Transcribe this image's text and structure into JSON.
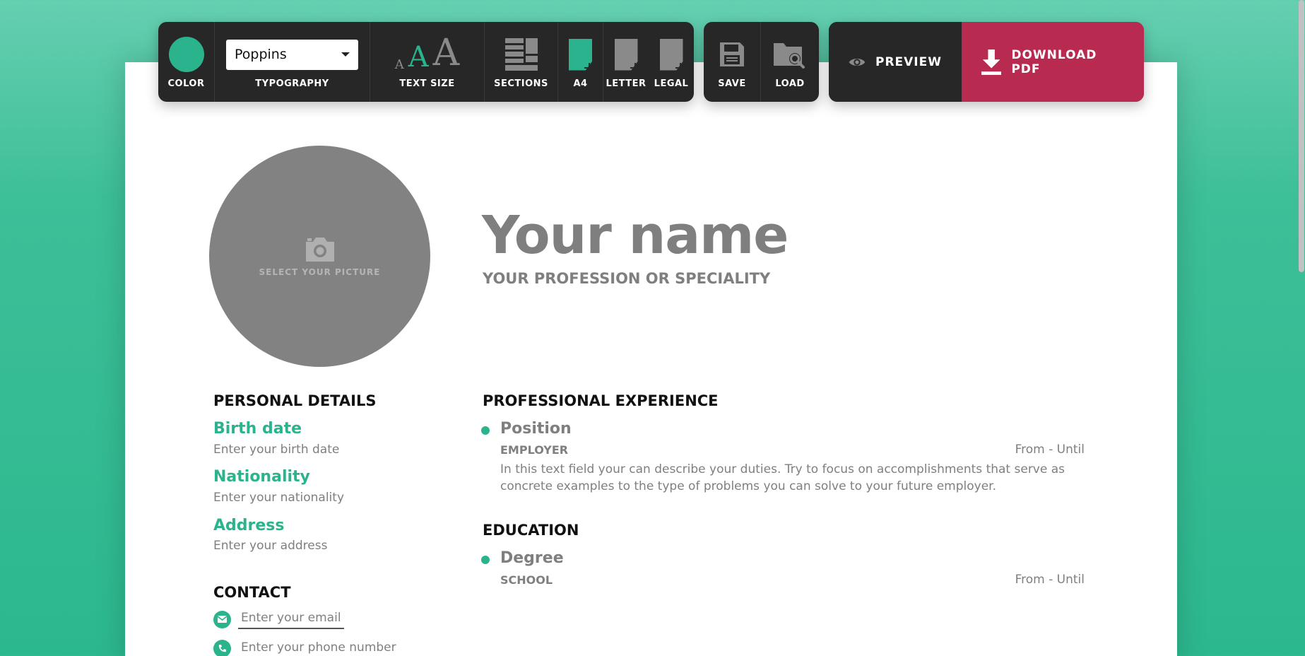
{
  "colors": {
    "accent": "#2ab38c",
    "download": "#b82a4f",
    "toolbar": "#272727",
    "muted": "#7f7f7f"
  },
  "toolbar": {
    "color_label": "COLOR",
    "typography_label": "TYPOGRAPHY",
    "typography_value": "Poppins",
    "text_size_label": "TEXT SIZE",
    "text_size_glyph_small": "A",
    "text_size_glyph_medium": "A",
    "text_size_glyph_large": "A",
    "sections_label": "SECTIONS",
    "a4_label": "A4",
    "letter_label": "LETTER",
    "legal_label": "LEGAL",
    "save_label": "SAVE",
    "load_label": "LOAD",
    "preview_label": "PREVIEW",
    "download_label": "DOWNLOAD PDF"
  },
  "resume": {
    "avatar_label": "SELECT YOUR PICTURE",
    "name": "Your name",
    "profession": "YOUR PROFESSION OR SPECIALITY",
    "personal_title": "PERSONAL DETAILS",
    "details": [
      {
        "label": "Birth date",
        "value": "Enter your birth date"
      },
      {
        "label": "Nationality",
        "value": "Enter your nationality"
      },
      {
        "label": "Address",
        "value": "Enter your address"
      }
    ],
    "contact_title": "CONTACT",
    "contact": {
      "email_placeholder": "Enter your email",
      "phone_placeholder": "Enter your phone number"
    },
    "experience_title": "PROFESSIONAL EXPERIENCE",
    "experience": {
      "position": "Position",
      "employer": "EMPLOYER",
      "dates": "From - Until",
      "description": "In this text field your can describe your duties. Try to focus on accomplishments that serve as concrete examples to the type of problems you can solve to your future employer."
    },
    "education_title": "EDUCATION",
    "education": {
      "degree": "Degree",
      "school": "SCHOOL",
      "dates": "From - Until"
    }
  },
  "icons": [
    "camera-icon",
    "eye-icon",
    "download-icon",
    "floppy-disk-icon",
    "folder-search-icon",
    "sections-icon",
    "email-icon",
    "phone-icon"
  ]
}
